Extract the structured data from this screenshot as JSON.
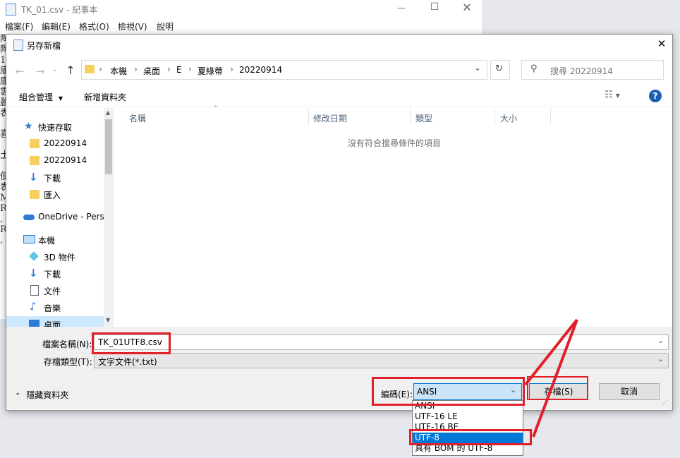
{
  "notepad": {
    "title": "TK_01.csv - 記事本",
    "menu": [
      "檔案(F)",
      "編輯(E)",
      "格式(O)",
      "檢視(V)",
      "說明"
    ],
    "text_lines": [
      "陶",
      "陶",
      "1",
      "康",
      "康",
      "雲",
      "麗",
      "表",
      "",
      "喜",
      "",
      "土",
      "",
      "便",
      "表",
      "M",
      "R",
      ",",
      "R",
      ","
    ]
  },
  "dialog": {
    "title": "另存新檔",
    "breadcrumb": [
      "本機",
      "桌面",
      "E",
      "夏綠蒂",
      "20220914"
    ],
    "search_placeholder": "搜尋 20220914",
    "toolbar": {
      "organize": "組合管理",
      "new_folder": "新增資料夾"
    },
    "nav": [
      {
        "label": "快速存取",
        "icon": "star-icon"
      },
      {
        "label": "20220914",
        "icon": "folder-icon"
      },
      {
        "label": "20220914",
        "icon": "folder-icon"
      },
      {
        "label": "下載",
        "icon": "download-icon"
      },
      {
        "label": "匯入",
        "icon": "folder-icon"
      },
      {
        "label": "OneDrive - Persc",
        "icon": "cloud-icon"
      },
      {
        "label": "本機",
        "icon": "computer-icon"
      },
      {
        "label": "3D 物件",
        "icon": "cube-icon"
      },
      {
        "label": "下載",
        "icon": "download-icon"
      },
      {
        "label": "文件",
        "icon": "document-icon"
      },
      {
        "label": "音樂",
        "icon": "music-icon"
      },
      {
        "label": "桌面",
        "icon": "desktop-icon"
      }
    ],
    "columns": [
      "名稱",
      "修改日期",
      "類型",
      "大小"
    ],
    "empty_message": "沒有符合搜尋條件的項目",
    "filename_label": "檔案名稱(N):",
    "filename_value": "TK_01UTF8.csv",
    "filetype_label": "存檔類型(T):",
    "filetype_value": "文字文件(*.txt)",
    "hide_folders": "隱藏資料夾",
    "encoding_label": "編碼(E):",
    "encoding_value": "ANSI",
    "encoding_options": [
      "ANSI",
      "UTF-16 LE",
      "UTF-16 BE",
      "UTF-8",
      "具有 BOM 的 UTF-8"
    ],
    "save_button": "存檔(S)",
    "cancel_button": "取消"
  },
  "colors": {
    "annotation_red": "#e0202a",
    "selected_blue": "#0078d7",
    "help_blue": "#1a5fb4"
  }
}
